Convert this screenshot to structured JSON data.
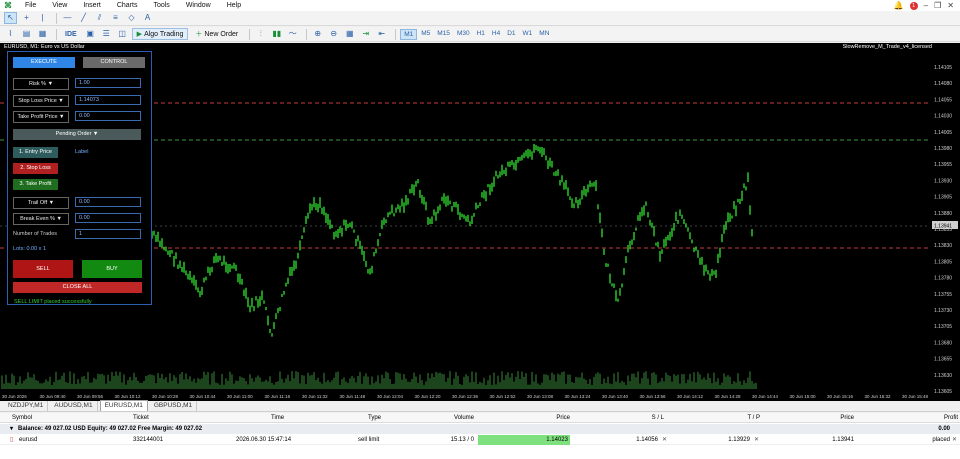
{
  "menu": [
    "File",
    "View",
    "Insert",
    "Charts",
    "Tools",
    "Window",
    "Help"
  ],
  "menu_right": {
    "notif_count": "1"
  },
  "toolbar": {
    "algo_trading": "Algo Trading",
    "new_order": "New Order",
    "ide": "IDE"
  },
  "timeframes": [
    "M1",
    "M5",
    "M15",
    "M30",
    "H1",
    "H4",
    "D1",
    "W1",
    "MN"
  ],
  "active_timeframe": "M1",
  "chart": {
    "title": "EURUSD, M1: Euro vs US Dollar",
    "ea_label": "SlowRemove_M_Trade_v4_licensed",
    "price_labels": [
      "1.14105",
      "1.14080",
      "1.14055",
      "1.14030",
      "1.14005",
      "1.13980",
      "1.13955",
      "1.13930",
      "1.13905",
      "1.13880",
      "1.13855",
      "1.13830",
      "1.13805",
      "1.13780",
      "1.13755",
      "1.13730",
      "1.13705",
      "1.13680",
      "1.13655",
      "1.13630",
      "1.13605"
    ],
    "current_price_tag": "1.13941",
    "time_labels": [
      "30 Jun 2026",
      "30 Jun 09:40",
      "30 Jun 09:56",
      "30 Jun 10:12",
      "30 Jun 10:28",
      "30 Jun 10:44",
      "30 Jun 11:00",
      "30 Jun 11:16",
      "30 Jun 11:32",
      "30 Jun 11:48",
      "30 Jun 12:04",
      "30 Jun 12:20",
      "30 Jun 12:36",
      "30 Jun 12:52",
      "30 Jun 13:08",
      "30 Jun 13:24",
      "30 Jun 13:40",
      "30 Jun 13:56",
      "30 Jun 14:12",
      "30 Jun 14:28",
      "30 Jun 14:44",
      "30 Jun 15:00",
      "30 Jun 15:16",
      "30 Jun 15:32",
      "30 Jun 15:48"
    ],
    "candle_color": "#2fd12f",
    "sl_line_color": "#c83a3a",
    "tp_line_color": "#3a9a3a"
  },
  "panel": {
    "tab_execute": "EXECUTE",
    "tab_control": "CONTROL",
    "risk_label": "Risk % ▼",
    "risk_value": "1.00",
    "stop_loss_label": "Stop Loss Price ▼",
    "stop_loss_value": "1.14073",
    "take_profit_label": "Take Profit Price ▼",
    "take_profit_value": "0.00",
    "pending_order": "Pending Order ▼",
    "entry_price_btn": "1. Entry Price",
    "entry_price_value": "Label",
    "stop_loss_btn": "2. Stop Loss",
    "take_profit_btn": "3. Take Profit",
    "trail_off_label": "Trail Off ▼",
    "trail_off_value": "0.00",
    "break_even_label": "Break Even % ▼",
    "break_even_value": "0.00",
    "num_trades_label": "Number of Trades",
    "num_trades_value": "1",
    "lots": "Lots: 0.00 x 1",
    "sell": "SELL",
    "buy": "BUY",
    "close_all": "CLOSE ALL",
    "status": "SELL LIMIT placed successfully"
  },
  "symbol_tabs": [
    "NZDJPY,M1",
    "AUDUSD,M1",
    "EURUSD,M1",
    "GBPUSD,M1"
  ],
  "active_symbol_tab": "EURUSD,M1",
  "table": {
    "headers": {
      "symbol": "Symbol",
      "ticket": "Ticket",
      "time": "Time",
      "type": "Type",
      "volume": "Volume",
      "price": "Price",
      "sl": "S / L",
      "tp": "T / P",
      "price2": "Price",
      "profit": "Profit"
    },
    "balance": "Balance: 49 027.02 USD  Equity: 49 027.02  Free Margin: 49 027.02",
    "balance_profit": "0.00",
    "order": {
      "symbol": "eurusd",
      "ticket": "332144001",
      "time": "2026.06.30 15:47:14",
      "type": "sell limit",
      "volume": "15.13 / 0",
      "price": "1.14023",
      "sl": "1.14056",
      "tp": "1.13929",
      "price2": "1.13941",
      "profit": "placed"
    }
  }
}
